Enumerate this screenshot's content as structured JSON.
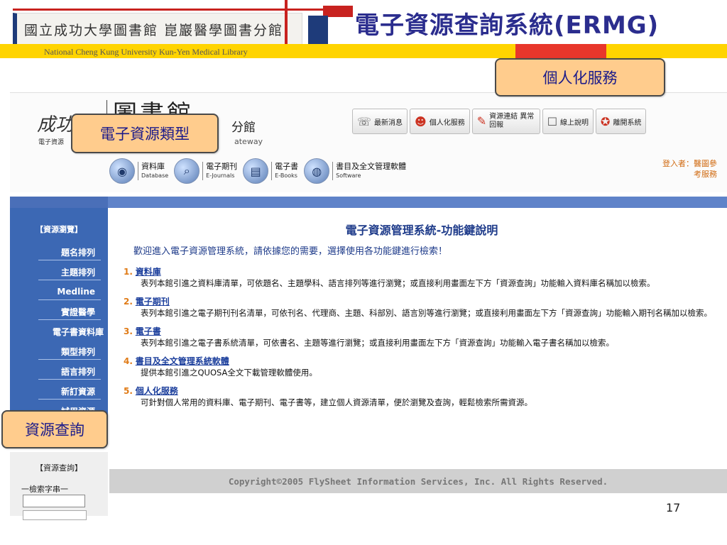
{
  "slide": {
    "library_logo": "國立成功大學圖書館 崑巖醫學圖書分館",
    "title": "電子資源查詢系統(ERMG)",
    "subtitle": "National Cheng Kung University Kun-Yen Medical Library",
    "page_number": "17"
  },
  "callouts": {
    "personal": "個人化服務",
    "types": "電子資源類型",
    "search": "資源查詢"
  },
  "site": {
    "logo_left": "成功",
    "logo_left_sub": "電子資源",
    "logo_mid": "圖書館",
    "logo_right": "分館",
    "logo_right_sub": "ateway"
  },
  "topnav": [
    {
      "label": "最新消息",
      "icon": "announcement-icon"
    },
    {
      "label": "個人化服務",
      "icon": "user-icon"
    },
    {
      "label": "資源連結 異常回報",
      "icon": "pencil-icon"
    },
    {
      "label": "線上說明",
      "icon": "help-icon"
    },
    {
      "label": "離開系統",
      "icon": "exit-icon"
    }
  ],
  "categories": [
    {
      "zh": "資料庫",
      "en": "Database"
    },
    {
      "zh": "電子期刊",
      "en": "E-Journals"
    },
    {
      "zh": "電子書",
      "en": "E-Books"
    },
    {
      "zh": "書目及全文管理軟體",
      "en": "Software"
    }
  ],
  "login": {
    "line1": "登入者：醫圖參",
    "line2": "考服務"
  },
  "sidebar": {
    "head": "【資源瀏覽】",
    "items": [
      "題名排列",
      "主題排列",
      "Medline",
      "實證醫學",
      "電子書資料庫",
      "類型排列",
      "語言排列",
      "新訂資源",
      "試用資源"
    ]
  },
  "search": {
    "title": "【資源查詢】",
    "label": "一檢索字串一"
  },
  "content": {
    "title": "電子資源管理系統-功能鍵說明",
    "intro": "歡迎進入電子資源管理系統，請依據您的需要，選擇使用各功能鍵進行檢索！",
    "items": [
      {
        "num": "1.",
        "name": "資料庫",
        "desc": "表列本館引進之資料庫清單，可依題名、主題學科、語言排列等進行瀏覽；或直接利用畫面左下方「資源查詢」功能輸入資料庫名稱加以檢索。"
      },
      {
        "num": "2.",
        "name": "電子期刊",
        "desc": "表列本館引進之電子期刊刊名清單，可依刊名、代理商、主題、科部別、語言別等進行瀏覽；或直接利用畫面左下方「資源查詢」功能輸入期刊名稱加以檢索。"
      },
      {
        "num": "3.",
        "name": "電子書",
        "desc": "表列本館引進之電子書系統清單，可依書名、主題等進行瀏覽；或直接利用畫面左下方「資源查詢」功能輸入電子書名稱加以檢索。"
      },
      {
        "num": "4.",
        "name": "書目及全文管理系統軟體",
        "desc": "提供本館引進之QUOSA全文下載管理軟體使用。"
      },
      {
        "num": "5.",
        "name": "個人化服務",
        "desc": "可針對個人常用的資料庫、電子期刊、電子書等，建立個人資源清單，便於瀏覽及查詢，輕鬆檢索所需資源。"
      }
    ]
  },
  "footer": "Copyright©2005 FlySheet Information Services, Inc. All Rights Reserved."
}
